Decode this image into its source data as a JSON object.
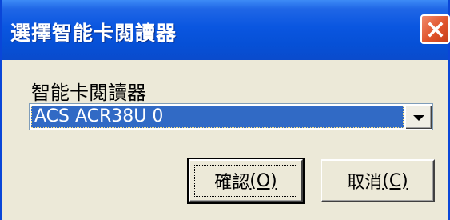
{
  "window": {
    "title": "選擇智能卡閱讀器",
    "close_icon": "close-x-icon"
  },
  "field": {
    "label": "智能卡閱讀器"
  },
  "reader_select": {
    "selected_value": "ACS ACR38U 0",
    "arrow_icon": "dropdown-arrow-icon"
  },
  "buttons": {
    "ok_label": "確認",
    "ok_mnemonic": "(O)",
    "cancel_label": "取消",
    "cancel_mnemonic": "(C)"
  },
  "colors": {
    "title_bar": "#0a56e0",
    "close_button": "#e0542b",
    "selection": "#316ac5",
    "dialog_face": "#ece9d8"
  }
}
